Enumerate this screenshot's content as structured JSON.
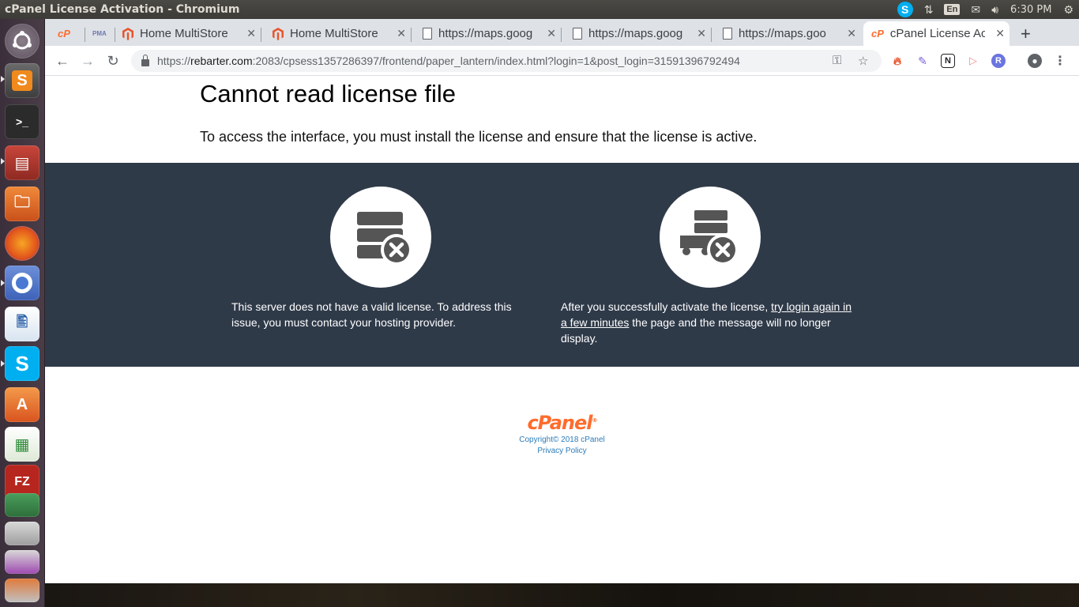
{
  "top_panel": {
    "window_title": "cPanel License Activation - Chromium",
    "keyboard_layout": "En",
    "clock": "6:30 PM"
  },
  "tabs": [
    {
      "label": "",
      "favicon": "cpanel-favicon"
    },
    {
      "label": "",
      "favicon": "phpmyadmin-favicon"
    },
    {
      "label": "Home MultiStore",
      "favicon": "magento-favicon"
    },
    {
      "label": "Home MultiStore",
      "favicon": "magento-favicon"
    },
    {
      "label": "https://maps.goog",
      "favicon": "document-favicon"
    },
    {
      "label": "https://maps.goog",
      "favicon": "document-favicon"
    },
    {
      "label": "https://maps.goo",
      "favicon": "document-favicon"
    },
    {
      "label": "cPanel License Act",
      "favicon": "cpanel-favicon",
      "active": true
    }
  ],
  "omnibox": {
    "scheme": "https://",
    "host": "rebarter.com",
    "rest": ":2083/cpsess1357286397/frontend/paper_lantern/index.html?login=1&post_login=31591396792494"
  },
  "page": {
    "heading": "Cannot read license file",
    "intro": "To access the interface, you must install the license and ensure that the license is active.",
    "left_text": "This server does not have a valid license. To address this issue, you must contact your hosting provider.",
    "right_text_before": "After you successfully activate the license, ",
    "right_link": "try login again in a few minutes",
    "right_text_after": " the page and the message will no longer display."
  },
  "footer": {
    "logo": "cPanel",
    "copyright": "Copyright© 2018 cPanel",
    "privacy": "Privacy Policy"
  },
  "colors": {
    "band": "#2f3a49",
    "cpanel_orange": "#ff6c2c",
    "link_blue": "#2b7bb9"
  }
}
